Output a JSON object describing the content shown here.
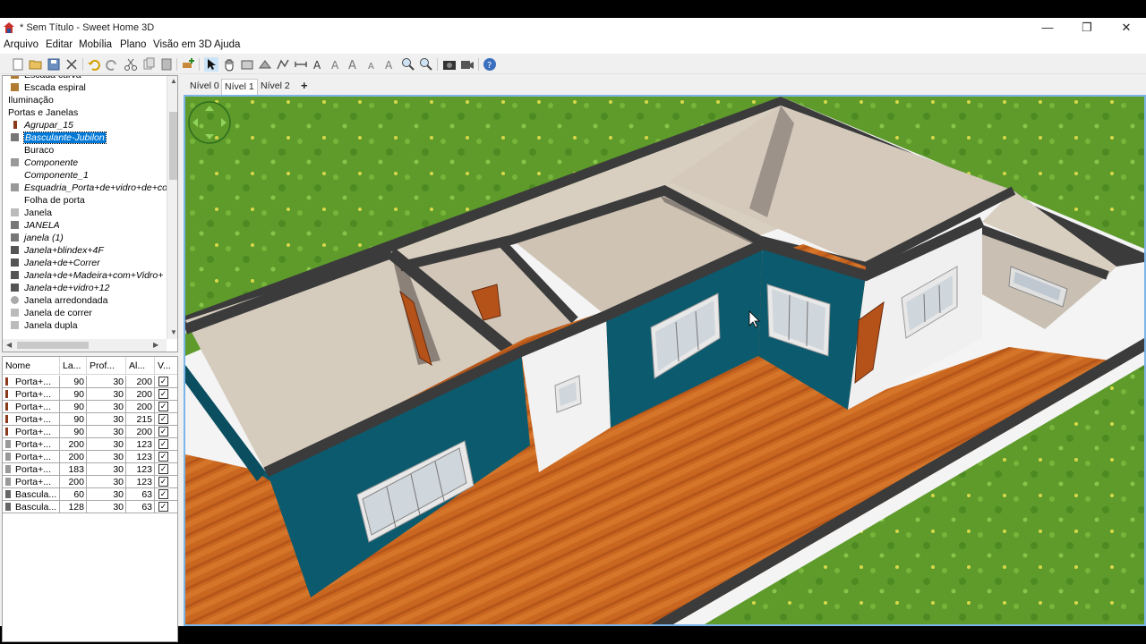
{
  "window": {
    "title": "* Sem Título - Sweet Home 3D",
    "controls": {
      "minimize": "—",
      "maximize": "❐",
      "close": "✕"
    }
  },
  "menu": [
    "Arquivo",
    "Editar",
    "Mobília",
    "Plano",
    "Visão em 3D",
    "Ajuda"
  ],
  "toolbar_icons": [
    "new-icon",
    "open-icon",
    "save-icon",
    "cut-tool-icon",
    "undo-icon",
    "redo-icon",
    "cut-icon",
    "copy-icon",
    "paste-icon",
    "add-furniture-icon",
    "select-icon",
    "pan-icon",
    "create-walls-icon",
    "create-rooms-icon",
    "create-polylines-icon",
    "create-dimensions-icon",
    "add-text-icon",
    "text-style-icon",
    "increase-text-icon",
    "decrease-text-icon",
    "zoom-in-icon",
    "zoom-out-icon",
    "create-photo-icon",
    "create-video-icon",
    "help-icon"
  ],
  "catalog": {
    "items": [
      {
        "label": "Escada curva",
        "indent": 1,
        "italic": false,
        "icon": "stair-icon",
        "color": "#b07a30"
      },
      {
        "label": "Escada espiral",
        "indent": 1,
        "italic": false,
        "icon": "stair-icon",
        "color": "#b07a30"
      },
      {
        "label": "Iluminação",
        "indent": 0,
        "italic": false,
        "icon": "",
        "color": ""
      },
      {
        "label": "Portas e Janelas",
        "indent": 0,
        "italic": false,
        "icon": "",
        "color": ""
      },
      {
        "label": "Agrupar_15",
        "indent": 1,
        "italic": true,
        "icon": "door-icon",
        "color": "#8a3a1a"
      },
      {
        "label": "Basculante-Jubilon",
        "indent": 1,
        "italic": true,
        "icon": "window-icon",
        "color": "#777777",
        "selected": true
      },
      {
        "label": "Buraco",
        "indent": 1,
        "italic": false,
        "icon": "",
        "color": ""
      },
      {
        "label": "Componente",
        "indent": 1,
        "italic": true,
        "icon": "window-icon",
        "color": "#999999"
      },
      {
        "label": "Componente_1",
        "indent": 1,
        "italic": true,
        "icon": "",
        "color": ""
      },
      {
        "label": "Esquadria_Porta+de+vidro+de+co",
        "indent": 1,
        "italic": true,
        "icon": "window-icon",
        "color": "#999999"
      },
      {
        "label": "Folha de porta",
        "indent": 1,
        "italic": false,
        "icon": "",
        "color": ""
      },
      {
        "label": "Janela",
        "indent": 1,
        "italic": false,
        "icon": "window-icon",
        "color": "#bbbbbb"
      },
      {
        "label": "JANELA",
        "indent": 1,
        "italic": true,
        "icon": "window-icon",
        "color": "#777777"
      },
      {
        "label": "janela (1)",
        "indent": 1,
        "italic": true,
        "icon": "window-icon",
        "color": "#777777"
      },
      {
        "label": "Janela+blindex+4F",
        "indent": 1,
        "italic": true,
        "icon": "window-icon",
        "color": "#555555"
      },
      {
        "label": "Janela+de+Correr",
        "indent": 1,
        "italic": true,
        "icon": "window-icon",
        "color": "#555555"
      },
      {
        "label": "Janela+de+Madeira+com+Vidro+",
        "indent": 1,
        "italic": true,
        "icon": "window-icon",
        "color": "#555555"
      },
      {
        "label": "Janela+de+vidro+12",
        "indent": 1,
        "italic": true,
        "icon": "window-icon",
        "color": "#555555"
      },
      {
        "label": "Janela arredondada",
        "indent": 1,
        "italic": false,
        "icon": "round-window-icon",
        "color": "#aaaaaa"
      },
      {
        "label": "Janela de correr",
        "indent": 1,
        "italic": false,
        "icon": "window-icon",
        "color": "#bbbbbb"
      },
      {
        "label": "Janela dupla",
        "indent": 1,
        "italic": false,
        "icon": "window-icon",
        "color": "#bbbbbb"
      }
    ]
  },
  "furniture_table": {
    "columns": [
      "Nome",
      "La...",
      "Prof...",
      "Al...",
      "V..."
    ],
    "rows": [
      {
        "name": "Porta+...",
        "width": "90",
        "depth": "30",
        "height": "200",
        "visible": true,
        "icon": "door-icon",
        "color": "#8a3a1a"
      },
      {
        "name": "Porta+...",
        "width": "90",
        "depth": "30",
        "height": "200",
        "visible": true,
        "icon": "door-icon",
        "color": "#8a3a1a"
      },
      {
        "name": "Porta+...",
        "width": "90",
        "depth": "30",
        "height": "200",
        "visible": true,
        "icon": "door-icon",
        "color": "#8a3a1a"
      },
      {
        "name": "Porta+...",
        "width": "90",
        "depth": "30",
        "height": "215",
        "visible": true,
        "icon": "door-icon",
        "color": "#8a3a1a"
      },
      {
        "name": "Porta+...",
        "width": "90",
        "depth": "30",
        "height": "200",
        "visible": true,
        "icon": "door-icon",
        "color": "#8a3a1a"
      },
      {
        "name": "Porta+...",
        "width": "200",
        "depth": "30",
        "height": "123",
        "visible": true,
        "icon": "window-icon",
        "color": "#999999"
      },
      {
        "name": "Porta+...",
        "width": "200",
        "depth": "30",
        "height": "123",
        "visible": true,
        "icon": "window-icon",
        "color": "#999999"
      },
      {
        "name": "Porta+...",
        "width": "183",
        "depth": "30",
        "height": "123",
        "visible": true,
        "icon": "window-icon",
        "color": "#999999"
      },
      {
        "name": "Porta+...",
        "width": "200",
        "depth": "30",
        "height": "123",
        "visible": true,
        "icon": "window-icon",
        "color": "#999999"
      },
      {
        "name": "Bascula...",
        "width": "60",
        "depth": "30",
        "height": "63",
        "visible": true,
        "icon": "window-icon",
        "color": "#666666"
      },
      {
        "name": "Bascula...",
        "width": "128",
        "depth": "30",
        "height": "63",
        "visible": true,
        "icon": "window-icon",
        "color": "#666666"
      }
    ]
  },
  "level_tabs": [
    "Nível 0",
    "Nível 1",
    "Nível 2"
  ],
  "active_level_tab": "Nível 1",
  "add_level_label": "+",
  "colors": {
    "grass": "#5d9a2a",
    "wall_top": "#3a3a3a",
    "wall_teal": "#0c5a6e",
    "wall_white": "#f2f2f2",
    "floor_wood": "#c8641e",
    "room_floor": "#d7cdbf",
    "selection_blue": "#0078d7"
  }
}
